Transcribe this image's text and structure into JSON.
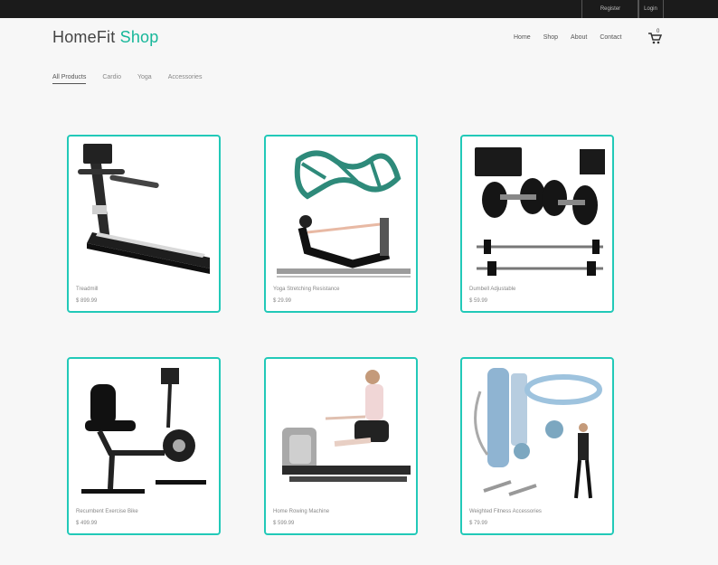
{
  "topbar": {
    "register_label": "Register",
    "login_label": "Login"
  },
  "brand": {
    "name_part1": "HomeFit",
    "name_part2": "Shop",
    "accent_color": "#17b79a"
  },
  "nav": {
    "items": [
      "Home",
      "Shop",
      "About",
      "Contact"
    ],
    "cart_count": "0"
  },
  "filters": {
    "items": [
      "All Products",
      "Cardio",
      "Yoga",
      "Accessories"
    ],
    "active_index": 0
  },
  "products": [
    {
      "name": "Treadmill",
      "price": "$ 899.99"
    },
    {
      "name": "Yoga Stretching Resistance",
      "price": "$ 29.99"
    },
    {
      "name": "Dumbell Adjustable",
      "price": "$ 59.99"
    },
    {
      "name": "Recumbent Exercise Bike",
      "price": "$ 499.99"
    },
    {
      "name": "Home Rowing Machine",
      "price": "$ 599.99"
    },
    {
      "name": "Weighted Fitness Accessories",
      "price": "$ 79.99"
    }
  ],
  "colors": {
    "card_border": "#22c9b8",
    "topbar_bg": "#1b1b1b"
  }
}
